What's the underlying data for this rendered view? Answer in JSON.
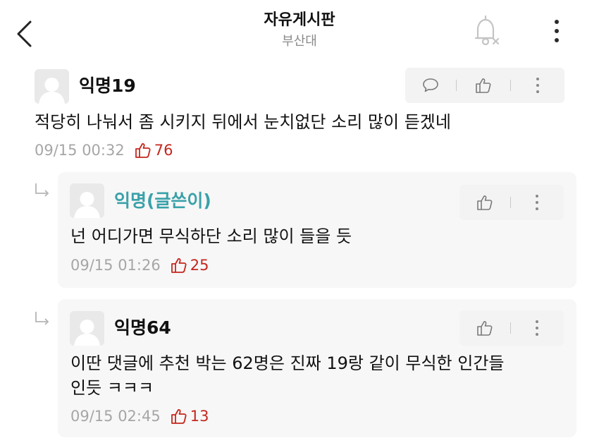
{
  "header": {
    "title": "자유게시판",
    "subtitle": "부산대"
  },
  "comments": [
    {
      "author": "익명19",
      "body": "적당히 나눠서 좀 시키지 뒤에서 눈치없단 소리 많이 듣겠네",
      "time": "09/15 00:32",
      "likes": "76"
    }
  ],
  "replies": [
    {
      "author": "익명(글쓴이)",
      "author_color": "#3aa1a9",
      "body": "넌 어디가면 무식하단 소리 많이 들을 듯",
      "time": "09/15 01:26",
      "likes": "25"
    },
    {
      "author": "익명64",
      "body_line1": "이딴 댓글에 추천 박는 62명은 진짜 19랑 같이 무식한 인간들",
      "body_line2": "인듯 ㅋㅋㅋ",
      "time": "09/15 02:45",
      "likes": "13"
    }
  ],
  "icons": {
    "back": "chevron-left-icon",
    "bell": "bell-off-icon",
    "more": "more-vertical-icon",
    "reply": "speech-bubble-icon",
    "like": "thumbs-up-icon",
    "reply_indicator": "reply-arrow-icon"
  },
  "colors": {
    "like_count": "#c4271e",
    "author_writer": "#3aa1a9",
    "meta_gray": "#a6a6a6",
    "subtitle_gray": "#8a8a8a"
  }
}
